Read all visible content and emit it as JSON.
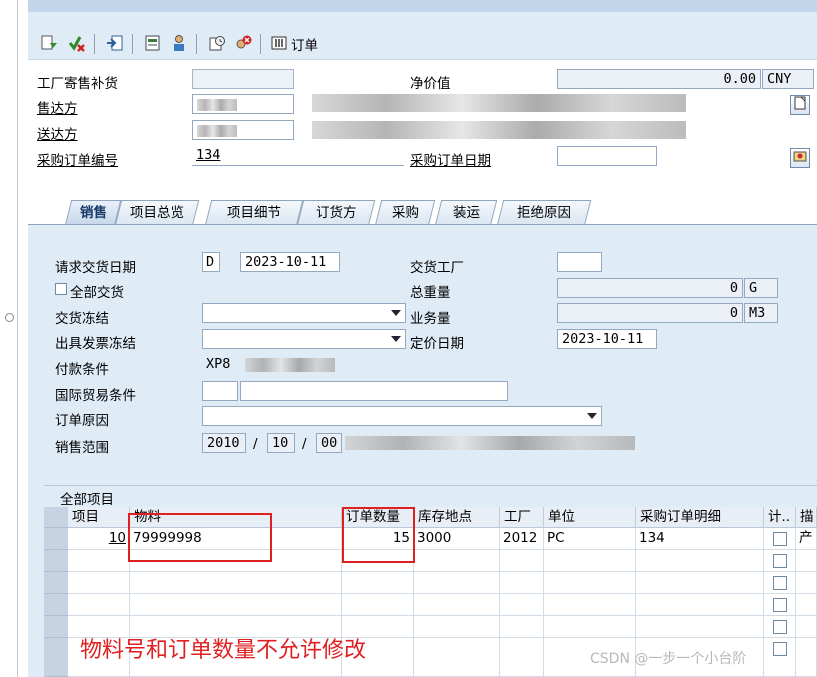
{
  "toolbar": {
    "icons": [
      "display-doc-icon",
      "check-icon",
      "export-icon",
      "header-icon",
      "partner-icon",
      "settings-icon",
      "cancel-icon",
      "orders-icon"
    ],
    "order_label": "订单"
  },
  "header": {
    "order_type_label": "工厂寄售补货",
    "net_value_label": "净价值",
    "net_value": "0.00",
    "currency": "CNY",
    "sold_to_label": "售达方",
    "ship_to_label": "送达方",
    "po_number_label": "采购订单编号",
    "po_number": "134",
    "po_date_label": "采购订单日期"
  },
  "tabs": [
    "销售",
    "项目总览",
    "项目细节",
    "订货方",
    "采购",
    "装运",
    "拒绝原因"
  ],
  "sales": {
    "req_delivery_date_label": "请求交货日期",
    "req_delivery_date_type": "D",
    "req_delivery_date": "2023-10-11",
    "delivering_plant_label": "交货工厂",
    "complete_delivery_label": "全部交货",
    "total_weight_label": "总重量",
    "total_weight": "0",
    "weight_unit": "G",
    "delivery_block_label": "交货冻结",
    "volume_label": "业务量",
    "volume": "0",
    "volume_unit": "M3",
    "billing_block_label": "出具发票冻结",
    "pricing_date_label": "定价日期",
    "pricing_date": "2023-10-11",
    "payment_terms_label": "付款条件",
    "payment_terms": "XP8",
    "incoterms_label": "国际贸易条件",
    "order_reason_label": "订单原因",
    "sales_area_label": "销售范围",
    "sales_org": "2010",
    "dist_channel": "10",
    "division": "00",
    "slash": "/"
  },
  "items": {
    "title": "全部项目",
    "columns": [
      "项目",
      "物料",
      "订单数量",
      "库存地点",
      "工厂",
      "单位",
      "采购订单明细",
      "计..",
      "描"
    ],
    "rows": [
      {
        "item": "10",
        "material": "79999998",
        "qty": "15",
        "sloc": "3000",
        "plant": "2012",
        "unit": "PC",
        "po_item": "134",
        "desc": "产"
      }
    ]
  },
  "annotation": {
    "note": "物料号和订单数量不允许修改",
    "color": "#e02020"
  },
  "watermark": "CSDN @一步一个小台阶"
}
